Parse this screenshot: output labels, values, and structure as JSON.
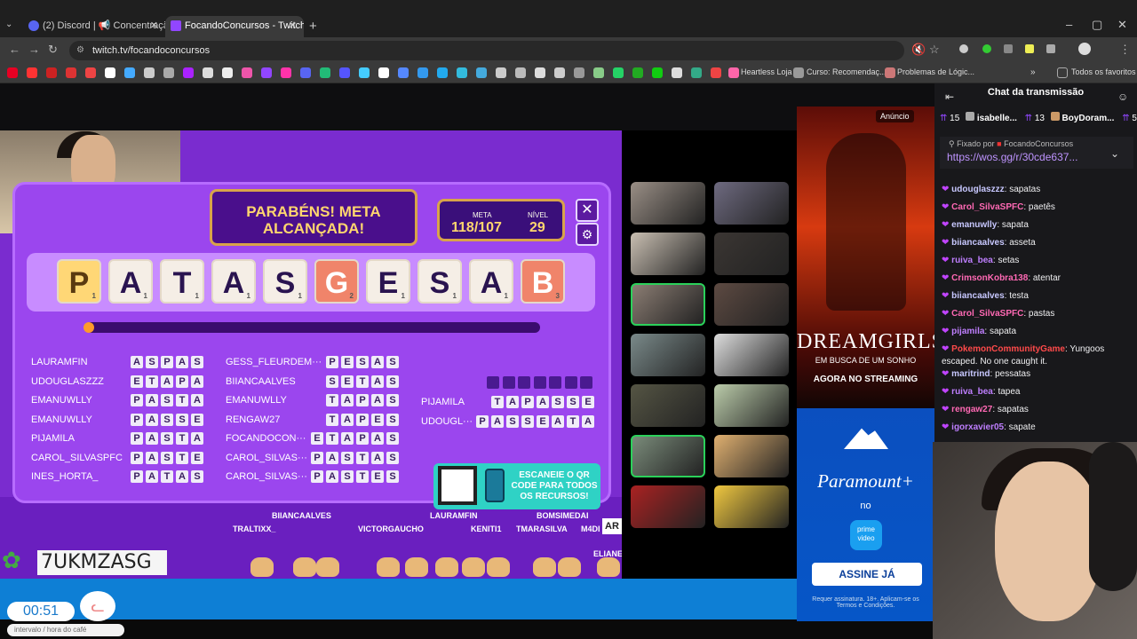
{
  "browser": {
    "tabs": [
      {
        "title": "(2) Discord | 📢 Concentração"
      },
      {
        "title": "FocandoConcursos - Twitch"
      }
    ],
    "url": "twitch.tv/focandoconcursos",
    "bookmarks": [
      "Heartless Loja",
      "Curso: Recomendaç...",
      "Problemas de Lógic...",
      "Todos os favoritos"
    ]
  },
  "game": {
    "banner": "PARABÉNS! META ALCANÇADA!",
    "meta_label": "META",
    "meta_value": "118/107",
    "nivel_label": "NÍVEL",
    "nivel_value": "29",
    "word_tiles": [
      {
        "letter": "P",
        "score": "1"
      },
      {
        "letter": "A",
        "score": "1"
      },
      {
        "letter": "T",
        "score": "1"
      },
      {
        "letter": "A",
        "score": "1"
      },
      {
        "letter": "S",
        "score": "1"
      },
      {
        "letter": "G",
        "score": "2"
      },
      {
        "letter": "E",
        "score": "1"
      },
      {
        "letter": "S",
        "score": "1"
      },
      {
        "letter": "A",
        "score": "1"
      },
      {
        "letter": "B",
        "score": "3"
      }
    ],
    "col1": [
      {
        "name": "LAURAMFIN",
        "word": "ASPAS"
      },
      {
        "name": "UDOUGLASZZZ",
        "word": "ETAPA"
      },
      {
        "name": "EMANUWLLY",
        "word": "PASTA"
      },
      {
        "name": "EMANUWLLY",
        "word": "PASSE"
      },
      {
        "name": "PIJAMILA",
        "word": "PASTA"
      },
      {
        "name": "CAROL_SILVASPFC",
        "word": "PASTE"
      },
      {
        "name": "INES_HORTA_",
        "word": "PATAS"
      }
    ],
    "col2": [
      {
        "name": "GESS_FLEURDEM···",
        "word": "PESAS"
      },
      {
        "name": "BIIANCAALVES",
        "word": "SETAS"
      },
      {
        "name": "EMANUWLLY",
        "word": "TAPAS"
      },
      {
        "name": "RENGAW27",
        "word": "TAPES"
      },
      {
        "name": "FOCANDOCON···",
        "word": "ETAPAS"
      },
      {
        "name": "CAROL_SILVAS···",
        "word": "PASTAS"
      },
      {
        "name": "CAROL_SILVAS···",
        "word": "PASTES"
      }
    ],
    "col3": [
      {
        "name": "PIJAMILA",
        "word": "TAPASSE"
      },
      {
        "name": "UDOUGL···",
        "word": "PASSEATA"
      }
    ],
    "qr_text": "ESCANEIE O QR CODE PARA TODOS OS RECURSOS!",
    "viewers": [
      "BIIANCAALVES",
      "TRALTIXX_",
      "VICTORGAUCHO",
      "LAURAMFIN",
      "KENITI1",
      "BOMSIMEDAI",
      "TMARASILVA",
      "M4DI",
      "ELIANE"
    ],
    "code": "7UKMZASG",
    "timer": "00:51",
    "timer_label": "intervalo / hora do café"
  },
  "ad": {
    "label": "Anúncio",
    "title1": "DREAMGIRLS",
    "title2": "EM BUSCA DE UM SONHO",
    "streaming": "AGORA NO STREAMING",
    "brand": "Paramount+",
    "no": "no",
    "prime": "prime video",
    "cta": "ASSINE JÁ",
    "fine": "Requer assinatura. 18+. Aplicam-se os Termos e Condições."
  },
  "chat": {
    "title": "Chat da transmissão",
    "badges": [
      {
        "count": "15",
        "name": "isabelle..."
      },
      {
        "count": "13",
        "name": "BoyDoram..."
      },
      {
        "count": "5",
        "name": ""
      }
    ],
    "pinned_by": "Fixado por",
    "pinned_user": "FocandoConcursos",
    "pinned_link": "https://wos.gg/r/30cde637...",
    "messages": [
      {
        "user": "udouglaszzz",
        "color": "#c8c8ff",
        "text": "sapatas"
      },
      {
        "user": "Carol_SilvaSPFC",
        "color": "#ff69b4",
        "text": "paetês"
      },
      {
        "user": "emanuwlly",
        "color": "#c8c8ff",
        "text": "sapata"
      },
      {
        "user": "biiancaalves",
        "color": "#c8c8ff",
        "text": "asseta"
      },
      {
        "user": "ruiva_bea",
        "color": "#bf7fff",
        "text": "setas"
      },
      {
        "user": "CrimsonKobra138",
        "color": "#ff69b4",
        "text": "atentar"
      },
      {
        "user": "biiancaalves",
        "color": "#c8c8ff",
        "text": "testa"
      },
      {
        "user": "Carol_SilvaSPFC",
        "color": "#ff69b4",
        "text": "pastas"
      },
      {
        "user": "pijamila",
        "color": "#bf7fff",
        "text": "sapata"
      },
      {
        "user": "PokemonCommunityGame",
        "color": "#ff4a4a",
        "text": "Yungoos escaped. No one caught it."
      },
      {
        "user": "maritrind",
        "color": "#c8c8ff",
        "text": "pessatas"
      },
      {
        "user": "ruiva_bea",
        "color": "#bf7fff",
        "text": "tapea"
      },
      {
        "user": "rengaw27",
        "color": "#ff69b4",
        "text": "sapatas"
      },
      {
        "user": "igorxavier05",
        "color": "#bf7fff",
        "text": "sapate"
      }
    ]
  }
}
